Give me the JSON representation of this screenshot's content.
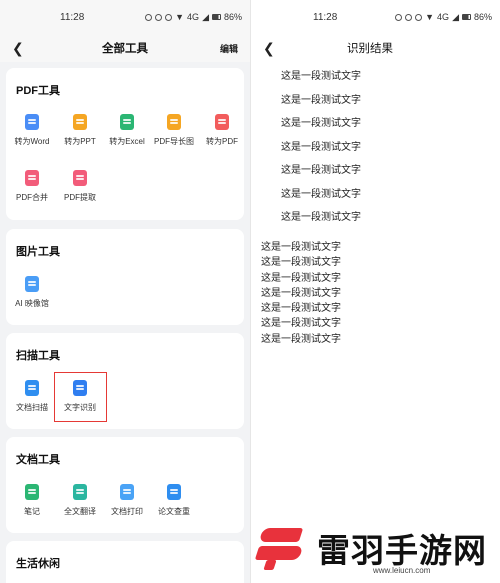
{
  "status": {
    "time": "11:28",
    "battery": "86%",
    "network": "4G"
  },
  "left": {
    "title": "全部工具",
    "edit_label": "编辑",
    "sections": [
      {
        "title": "PDF工具",
        "tools": [
          {
            "label": "转为Word",
            "icon": "word-doc-icon",
            "color": "#4a8df6"
          },
          {
            "label": "转为PPT",
            "icon": "ppt-doc-icon",
            "color": "#f5a623"
          },
          {
            "label": "转为Excel",
            "icon": "excel-doc-icon",
            "color": "#2bb673"
          },
          {
            "label": "PDF导长图",
            "icon": "long-image-icon",
            "color": "#f5a623"
          },
          {
            "label": "转为PDF",
            "icon": "pdf-doc-icon",
            "color": "#f25c5c"
          },
          {
            "label": "PDF合并",
            "icon": "pdf-merge-icon",
            "color": "#f25c7a"
          },
          {
            "label": "PDF提取",
            "icon": "pdf-extract-icon",
            "color": "#f25c7a"
          }
        ]
      },
      {
        "title": "图片工具",
        "tools": [
          {
            "label": "AI 映像馆",
            "icon": "ai-image-icon",
            "color": "#4a9df6"
          }
        ]
      },
      {
        "title": "扫描工具",
        "tools": [
          {
            "label": "文档扫描",
            "icon": "doc-scan-icon",
            "color": "#2f8ef0"
          },
          {
            "label": "文字识别",
            "icon": "ocr-icon",
            "color": "#2f7ef0"
          }
        ]
      },
      {
        "title": "文档工具",
        "tools": [
          {
            "label": "笔记",
            "icon": "note-icon",
            "color": "#2bb673"
          },
          {
            "label": "全文翻译",
            "icon": "translate-icon",
            "color": "#2bb6a0"
          },
          {
            "label": "文档打印",
            "icon": "print-icon",
            "color": "#4aa3f6"
          },
          {
            "label": "论文查重",
            "icon": "paper-check-icon",
            "color": "#2f8ef0"
          }
        ]
      },
      {
        "title": "生活休闲",
        "tools": []
      }
    ]
  },
  "right": {
    "title": "识别结果",
    "spaced_lines": [
      "这是一段测试文字",
      "这是一段测试文字",
      "这是一段测试文字",
      "这是一段测试文字",
      "这是一段测试文字",
      "这是一段测试文字",
      "这是一段测试文字"
    ],
    "plain_lines": [
      "这是一段测试文字",
      "这是一段测试文字",
      "这是一段测试文字",
      "这是一段测试文字",
      "这是一段测试文字",
      "这是一段测试文字",
      "这是一段测试文字"
    ]
  },
  "watermark": {
    "text": "雷羽手游网",
    "url": "www.leiucn.com",
    "color": "#e8323c"
  }
}
